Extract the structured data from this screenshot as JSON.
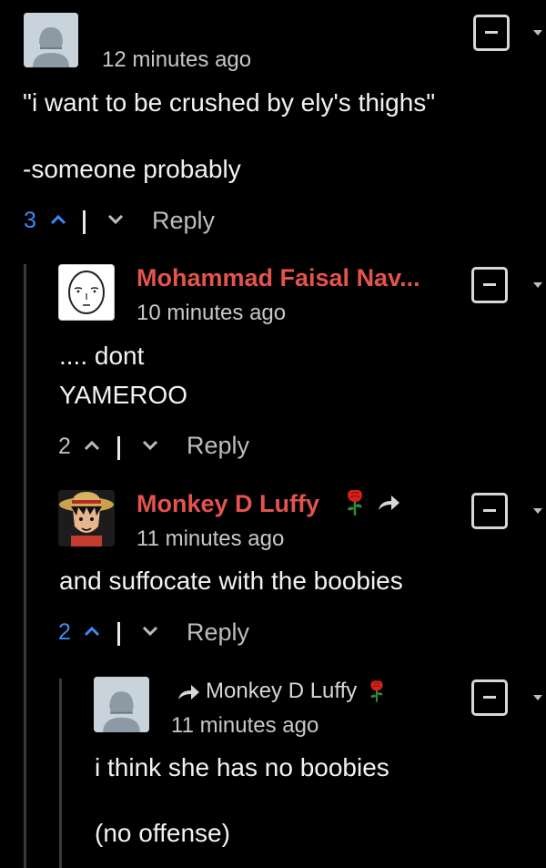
{
  "comments": [
    {
      "author": "",
      "time": "12 minutes ago",
      "lines": [
        "\"i want to be crushed by ely's thighs\"",
        "-someone probably"
      ],
      "votes": "3",
      "vote_color": "#3d8af7",
      "reply_label": "Reply"
    },
    {
      "author": "Mohammad Faisal Nav...",
      "time": "10 minutes ago",
      "lines": [
        ".... dont",
        "YAMEROO"
      ],
      "votes": "2",
      "vote_color": "#bdbdbd",
      "reply_label": "Reply"
    },
    {
      "author": "Monkey D Luffy",
      "time": "11 minutes ago",
      "lines": [
        "and suffocate with the boobies"
      ],
      "votes": "2",
      "vote_color": "#3d8af7",
      "reply_label": "Reply"
    },
    {
      "author": "",
      "reply_to": "Monkey D Luffy",
      "time": "11 minutes ago",
      "lines": [
        "i think she has no boobies",
        "(no offense)"
      ]
    }
  ],
  "colors": {
    "author": "#e2544c",
    "upvoted": "#3d8af7",
    "muted": "#bdbdbd",
    "background": "#000000"
  },
  "icons": {
    "collapse": "minus-square-icon",
    "menu": "caret-down-icon",
    "upvote": "chevron-up-icon",
    "downvote": "chevron-down-icon",
    "reply_arrow": "share-arrow-icon",
    "badge": "rose-icon"
  }
}
